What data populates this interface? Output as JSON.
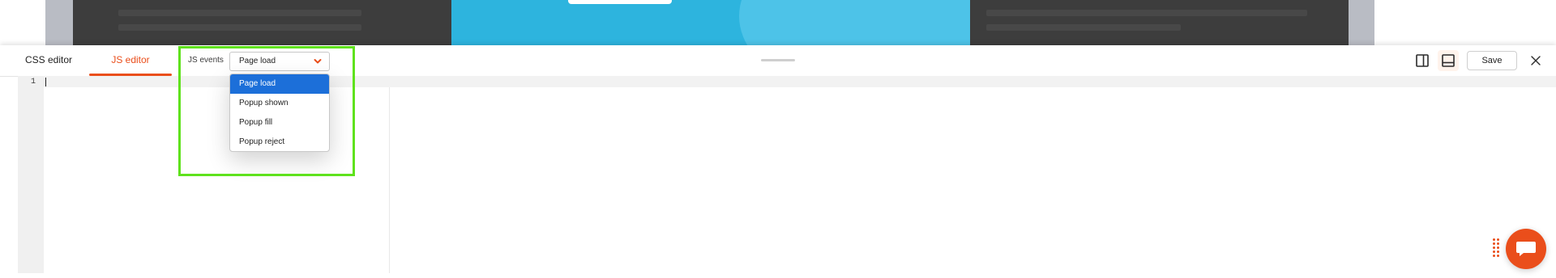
{
  "tabs": {
    "css_label": "CSS editor",
    "js_label": "JS editor",
    "active": "JS editor"
  },
  "js_events": {
    "label": "JS events",
    "selected": "Page load",
    "options": [
      "Page load",
      "Popup shown",
      "Popup fill",
      "Popup reject"
    ]
  },
  "editor": {
    "line_numbers": [
      "1"
    ]
  },
  "toolbar": {
    "save_label": "Save",
    "icons": [
      "layout-side-panel-icon",
      "layout-bottom-panel-icon",
      "close-icon"
    ]
  },
  "colors": {
    "accent": "#ea4e1b",
    "selection": "#1c6fd9",
    "highlight": "#5fe21d",
    "preview_blue": "#2db4de"
  }
}
